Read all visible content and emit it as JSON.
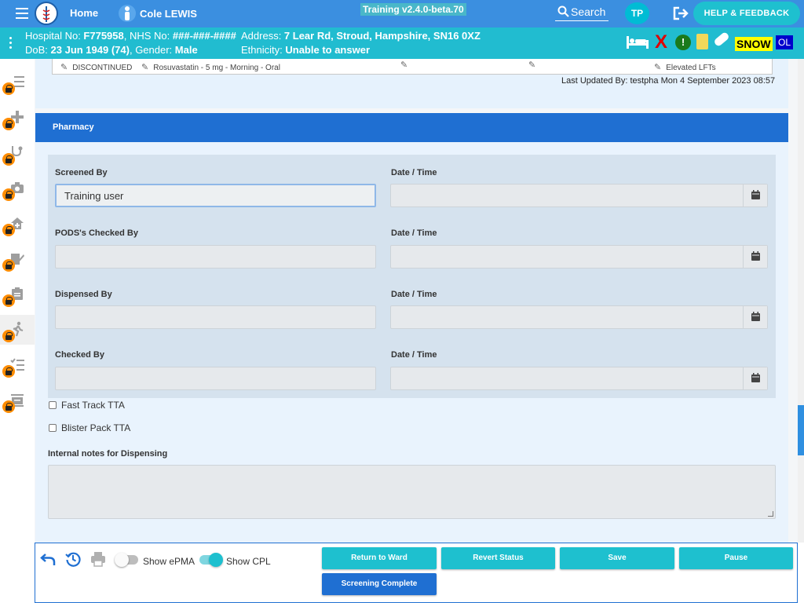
{
  "topbar": {
    "home": "Home",
    "patient_name": "Cole LEWIS",
    "version": "Training v2.4.0-beta.70",
    "search_label": "Search",
    "user_initials": "TP",
    "help_feedback": "HELP & FEEDBACK"
  },
  "banner": {
    "hospital_label": "Hospital No: ",
    "hospital_no": "F775958",
    "nhs_label": ", NHS No: ",
    "nhs_no": "###-###-####",
    "address_label": "Address: ",
    "address": "7 Lear Rd, Stroud, Hampshire, SN16 0XZ",
    "dob_label": "DoB: ",
    "dob": "23 Jun 1949 (74)",
    "gender_label": ", Gender: ",
    "gender": "Male",
    "ethnicity_label": "Ethnicity: ",
    "ethnicity": "Unable to answer",
    "alert_x": "X",
    "alert_mark": "!",
    "snow_badge": "SNOW",
    "ol_badge": "OL"
  },
  "medication_row": {
    "status": "DISCONTINUED",
    "drug": "Rosuvastatin - 5 mg - Morning - Oral",
    "reason": "Elevated LFTs"
  },
  "last_updated": "Last Updated By: testpha Mon 4 September 2023 08:57",
  "pharmacy": {
    "header": "Pharmacy",
    "fields": [
      {
        "label": "Screened By",
        "value": "Training user",
        "date_label": "Date / Time",
        "date_value": ""
      },
      {
        "label": "PODS's Checked By",
        "value": "",
        "date_label": "Date / Time",
        "date_value": ""
      },
      {
        "label": "Dispensed By",
        "value": "",
        "date_label": "Date / Time",
        "date_value": ""
      },
      {
        "label": "Checked By",
        "value": "",
        "date_label": "Date / Time",
        "date_value": ""
      }
    ],
    "checkboxes": [
      {
        "label": "Fast Track TTA",
        "checked": false
      },
      {
        "label": "Blister Pack TTA",
        "checked": false
      }
    ],
    "notes_label": "Internal notes for Dispensing",
    "notes_value": ""
  },
  "bottom_bar": {
    "show_epma_label": "Show ePMA",
    "show_epma_on": false,
    "show_cpl_label": "Show CPL",
    "show_cpl_on": true,
    "buttons": {
      "return_to_ward": "Return to Ward",
      "revert_status": "Revert Status",
      "save": "Save",
      "pause": "Pause",
      "screening_complete": "Screening Complete"
    }
  },
  "sidebar": {
    "items": [
      "list-icon",
      "add-icon",
      "stethoscope-icon",
      "camera-icon",
      "home-plus-icon",
      "prescription-edit-icon",
      "clipboard-icon",
      "walking-person-icon",
      "checklist-icon",
      "cash-register-icon"
    ]
  },
  "colors": {
    "topbar": "#3b8fe0",
    "banner": "#21bcd0",
    "accent_cyan": "#1ec0cf",
    "primary_blue": "#1f6fd2",
    "lock_orange": "#ff8c00"
  }
}
